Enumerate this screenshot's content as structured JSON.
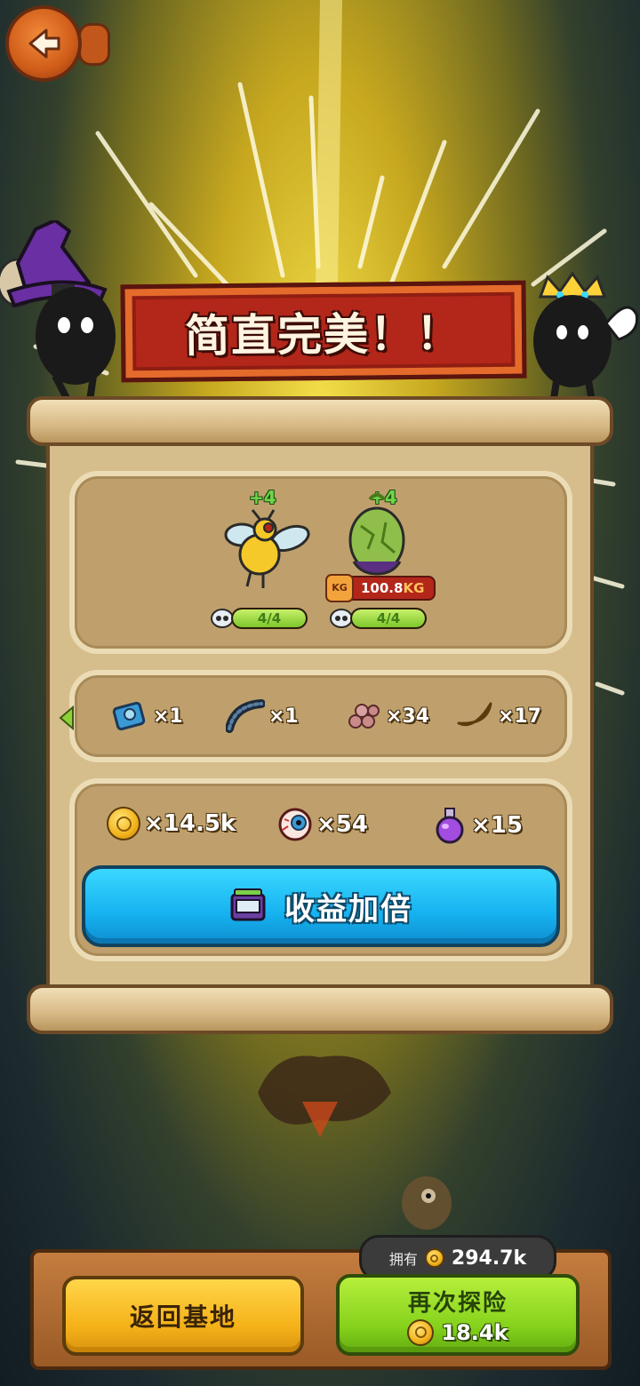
{
  "banner": {
    "title": "简直完美！！"
  },
  "creatures": [
    {
      "name": "bee",
      "bonus": "+4",
      "hp": "4/4",
      "hp_fraction": 1.0
    },
    {
      "name": "melon",
      "bonus": "+4",
      "hp": "4/4",
      "hp_fraction": 1.0,
      "weight_value": "100.8",
      "weight_unit": "KG",
      "tag": "KG"
    }
  ],
  "materials": [
    {
      "icon": "blue-gear-icon",
      "qty": "×1"
    },
    {
      "icon": "caterpillar-icon",
      "qty": "×1"
    },
    {
      "icon": "seeds-icon",
      "qty": "×34"
    },
    {
      "icon": "melon-slice-icon",
      "qty": "×17"
    }
  ],
  "rewards": [
    {
      "icon": "coin-icon",
      "qty": "×14.5k"
    },
    {
      "icon": "eyeball-icon",
      "qty": "×54"
    },
    {
      "icon": "potion-icon",
      "qty": "×15"
    }
  ],
  "double_button": {
    "label": "收益加倍",
    "icon": "tv-ad-icon"
  },
  "bottom": {
    "own_label": "拥有",
    "own_value": "294.7k",
    "return_label": "返回基地",
    "explore_label": "再次探险",
    "explore_cost": "18.4k"
  },
  "colors": {
    "banner": "#b3261a",
    "double_button": "#16b2f0",
    "return_button": "#f5b118",
    "explore_button": "#86d21c"
  }
}
